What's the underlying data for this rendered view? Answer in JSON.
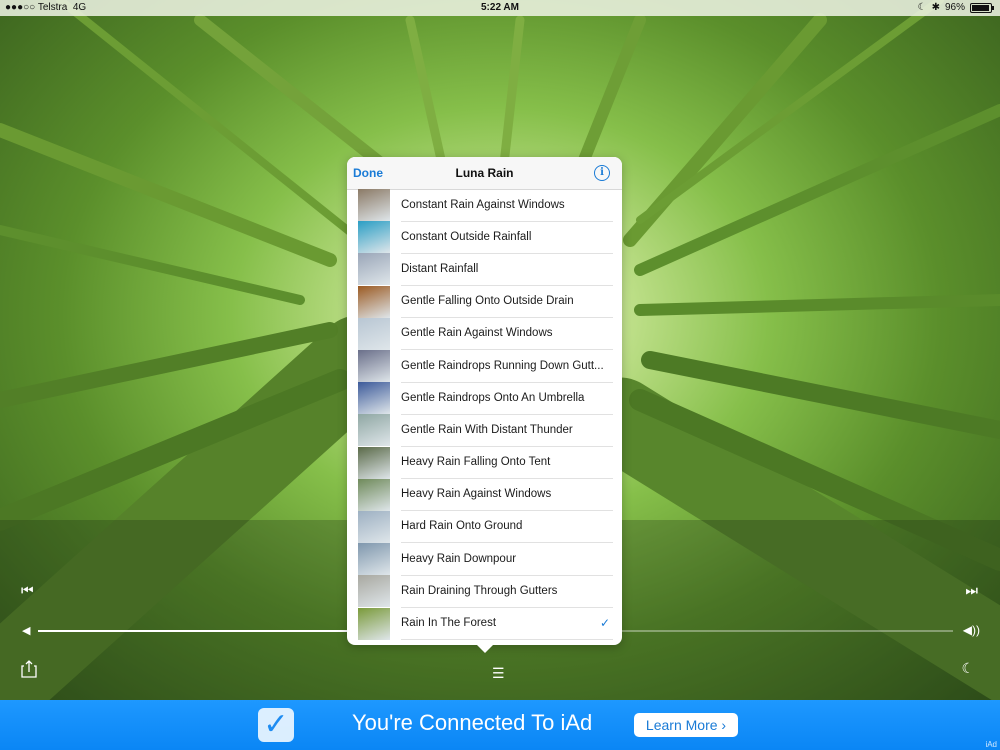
{
  "status_bar": {
    "signal": "●●●○○",
    "carrier": "Telstra",
    "network": "4G",
    "time": "5:22 AM",
    "moon": "☾",
    "bluetooth": "✱",
    "battery_text": "96%",
    "battery_level": 0.96
  },
  "popover": {
    "done_label": "Done",
    "title": "Luna Rain",
    "info_label": "i",
    "tracks": [
      {
        "label": "Constant Rain Against Windows",
        "thumb_color": "#8b7a66"
      },
      {
        "label": "Constant Outside Rainfall",
        "thumb_color": "#2a9ec4"
      },
      {
        "label": "Distant Rainfall",
        "thumb_color": "#9aa6b8"
      },
      {
        "label": "Gentle Falling Onto Outside Drain",
        "thumb_color": "#9b5a22"
      },
      {
        "label": "Gentle Rain Against Windows",
        "thumb_color": "#b8c6d3"
      },
      {
        "label": "Gentle Raindrops Running Down Gutt...",
        "thumb_color": "#6a6f8a"
      },
      {
        "label": "Gentle Raindrops Onto An Umbrella",
        "thumb_color": "#3c5a9a"
      },
      {
        "label": "Gentle Rain With Distant Thunder",
        "thumb_color": "#8fa7a3"
      },
      {
        "label": "Heavy Rain Falling Onto Tent",
        "thumb_color": "#5a6a48"
      },
      {
        "label": "Heavy Rain Against Windows",
        "thumb_color": "#6f8a5a"
      },
      {
        "label": "Hard Rain Onto Ground",
        "thumb_color": "#9db0c2"
      },
      {
        "label": "Heavy Rain Downpour",
        "thumb_color": "#7f97ad"
      },
      {
        "label": "Rain Draining Through Gutters",
        "thumb_color": "#a8a8a0"
      },
      {
        "label": "Rain In The Forest",
        "thumb_color": "#7a9a3a",
        "selected": true,
        "check": "✓"
      }
    ]
  },
  "controls": {
    "prev_icon": "⏮",
    "next_icon": "⏭",
    "volume_low_icon": "◀",
    "volume_high_icon": "◀))",
    "volume_level": 0.49,
    "list_icon": "☰",
    "sleep_icon": "☾"
  },
  "ad": {
    "check_icon": "✓",
    "text": "You're Connected To iAd",
    "learn_more": "Learn More ›",
    "mark": "iAd"
  },
  "colors": {
    "accent": "#1a7bd6",
    "ad_blue": "#0a86f5"
  }
}
